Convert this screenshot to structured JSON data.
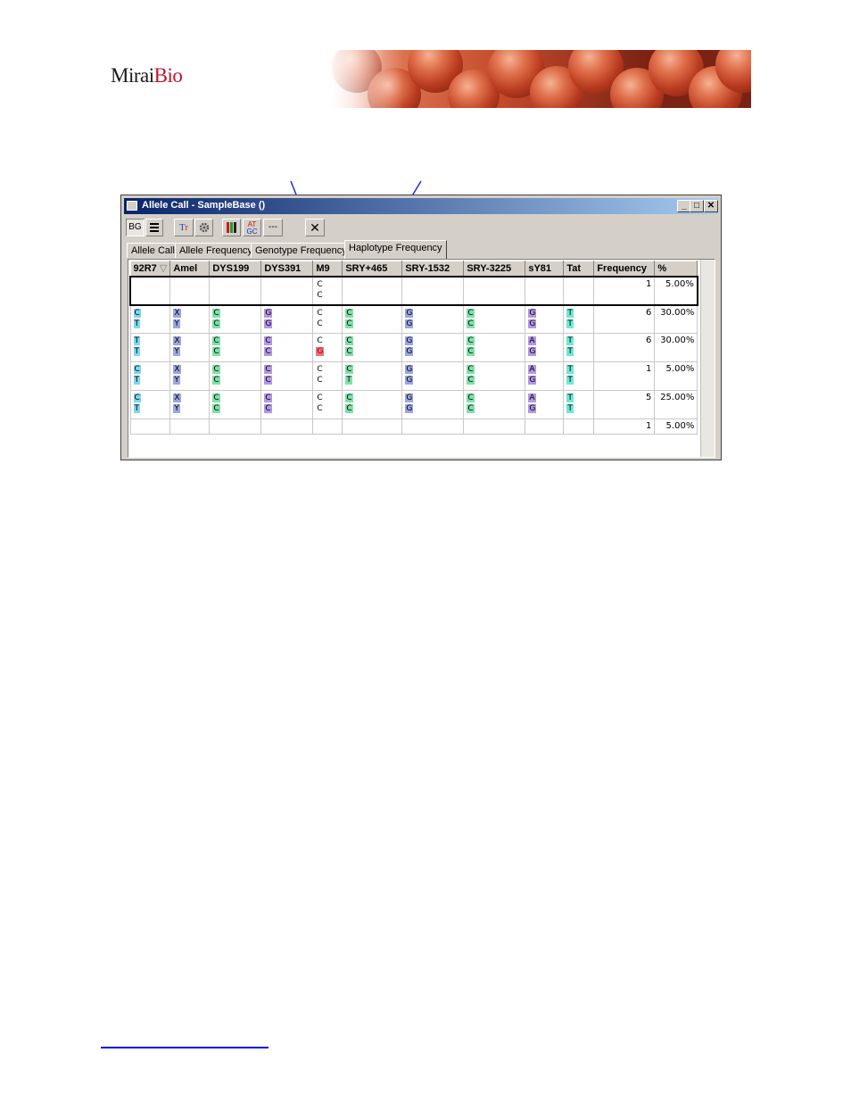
{
  "logo": {
    "text_a": "Mirai",
    "text_b": "Bio"
  },
  "window": {
    "title": "Allele Call - SampleBase ()",
    "controls": {
      "minimize": "_",
      "maximize": "□",
      "close": "✕"
    }
  },
  "toolbar": {
    "bg_label": "BG",
    "list_icon": "list-view-icon",
    "font_icon": "font-style-icon",
    "settings_icon": "gear-icon",
    "color_icon": "color-bars-icon",
    "atgc_label": "AT\nGC",
    "dash_label": "---",
    "close_label": "✕"
  },
  "tabs": [
    "Allele Call",
    "Allele Frequency",
    "Genotype Frequency",
    "Haplotype Frequency"
  ],
  "active_tab": 3,
  "table": {
    "headers": [
      "92R7",
      "Amel",
      "DYS199",
      "DYS391",
      "M9",
      "SRY+465",
      "SRY-1532",
      "SRY-3225",
      "sY81",
      "Tat",
      "Frequency",
      "%"
    ],
    "rows": [
      {
        "alleles": [
          [],
          [],
          [],
          [],
          [
            "C",
            "C"
          ],
          [],
          [],
          [],
          [],
          []
        ],
        "frequency": "1",
        "percent": "5.00%"
      },
      {
        "alleles": [
          [
            "C",
            "T"
          ],
          [
            "X",
            "Y"
          ],
          [
            "C",
            "C"
          ],
          [
            "G",
            "G"
          ],
          [
            "C",
            "C"
          ],
          [
            "C",
            "C"
          ],
          [
            "G",
            "G"
          ],
          [
            "C",
            "C"
          ],
          [
            "G",
            "G"
          ],
          [
            "T",
            "T"
          ]
        ],
        "frequency": "6",
        "percent": "30.00%"
      },
      {
        "alleles": [
          [
            "T",
            "T"
          ],
          [
            "X",
            "Y"
          ],
          [
            "C",
            "C"
          ],
          [
            "C",
            "C"
          ],
          [
            "C",
            "G"
          ],
          [
            "C",
            "C"
          ],
          [
            "G",
            "G"
          ],
          [
            "C",
            "C"
          ],
          [
            "A",
            "G"
          ],
          [
            "T",
            "T"
          ]
        ],
        "frequency": "6",
        "percent": "30.00%"
      },
      {
        "alleles": [
          [
            "C",
            "T"
          ],
          [
            "X",
            "Y"
          ],
          [
            "C",
            "C"
          ],
          [
            "C",
            "C"
          ],
          [
            "C",
            "C"
          ],
          [
            "C",
            "T"
          ],
          [
            "G",
            "G"
          ],
          [
            "C",
            "C"
          ],
          [
            "A",
            "G"
          ],
          [
            "T",
            "T"
          ]
        ],
        "frequency": "1",
        "percent": "5.00%"
      },
      {
        "alleles": [
          [
            "C",
            "T"
          ],
          [
            "X",
            "Y"
          ],
          [
            "C",
            "C"
          ],
          [
            "C",
            "C"
          ],
          [
            "C",
            "C"
          ],
          [
            "C",
            "C"
          ],
          [
            "G",
            "G"
          ],
          [
            "C",
            "C"
          ],
          [
            "A",
            "G"
          ],
          [
            "T",
            "T"
          ]
        ],
        "frequency": "5",
        "percent": "25.00%"
      },
      {
        "alleles": [
          [],
          [],
          [],
          [],
          [],
          [],
          [],
          [],
          [],
          []
        ],
        "frequency": "1",
        "percent": "5.00%"
      }
    ],
    "column_colors": [
      "#7fd8ee",
      "#9aa6e4",
      "#7fe0a8",
      "#b398e6",
      "",
      "#7fe0a8",
      "#9aa6e4",
      "#7fe0a8",
      "#b398e6",
      "#6fe8d2"
    ],
    "highlight_color": "#f07080"
  },
  "colors": {
    "accent_arrow": "#1f2fd0",
    "title_start": "#0a246a",
    "title_end": "#a6caf0"
  }
}
